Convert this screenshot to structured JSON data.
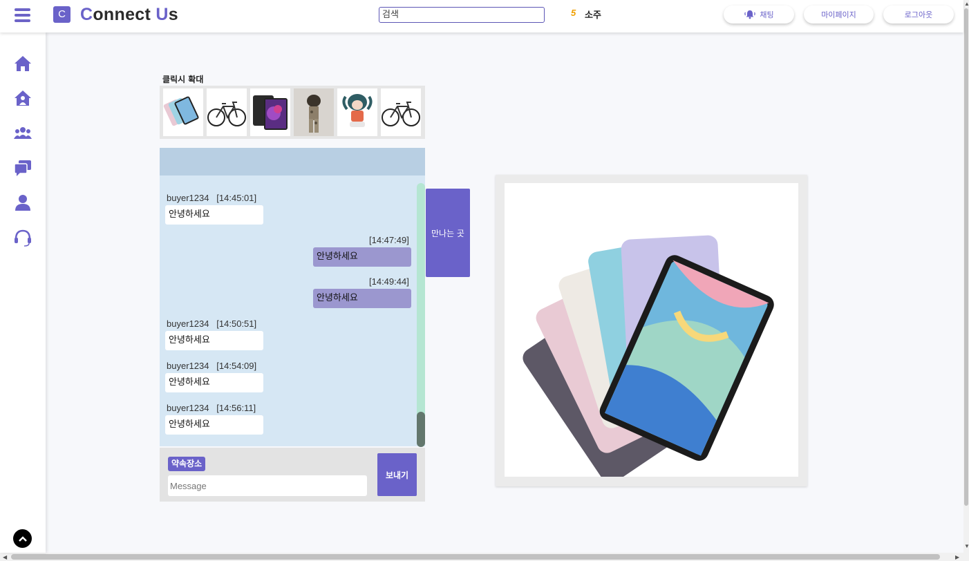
{
  "header": {
    "brand_letter": "C",
    "brand_first_initial": "C",
    "brand_first_rest": "onnect ",
    "brand_second_initial": "U",
    "brand_second_rest": "s",
    "search_placeholder": "검색",
    "location_number": "5",
    "location_name": "소주",
    "chat_label": "채팅",
    "mypage_label": "마이페이지",
    "logout_label": "로그아웃"
  },
  "sidebar": {
    "items": [
      "home-icon",
      "community-home-icon",
      "group-icon",
      "chat-bubbles-icon",
      "user-icon",
      "headset-icon"
    ]
  },
  "gallery": {
    "label": "클릭시 확대",
    "thumbnails": [
      "tablet-colors",
      "bicycle",
      "tablet-dark",
      "camo-outfit",
      "character-illustration",
      "bicycle"
    ]
  },
  "chat": {
    "messages": [
      {
        "side": "in",
        "sender": "buyer1234",
        "time": "[14:45:01]",
        "text": "안녕하세요"
      },
      {
        "side": "out",
        "time": "[14:47:49]",
        "text": "안녕하세요"
      },
      {
        "side": "out",
        "time": "[14:49:44]",
        "text": "안녕하세요"
      },
      {
        "side": "in",
        "sender": "buyer1234",
        "time": "[14:50:51]",
        "text": "안녕하세요"
      },
      {
        "side": "in",
        "sender": "buyer1234",
        "time": "[14:54:09]",
        "text": "안녕하세요"
      },
      {
        "side": "in",
        "sender": "buyer1234",
        "time": "[14:56:11]",
        "text": "안녕하세요"
      }
    ],
    "meet_button": "만나는 곳",
    "place_tag": "약속장소",
    "input_placeholder": "Message",
    "send_button": "보내기"
  },
  "colors": {
    "accent": "#6a62c9",
    "outgoing_bubble": "#9b97cf",
    "chat_bg": "#d6e7f4",
    "chat_header": "#b8cfe3"
  }
}
